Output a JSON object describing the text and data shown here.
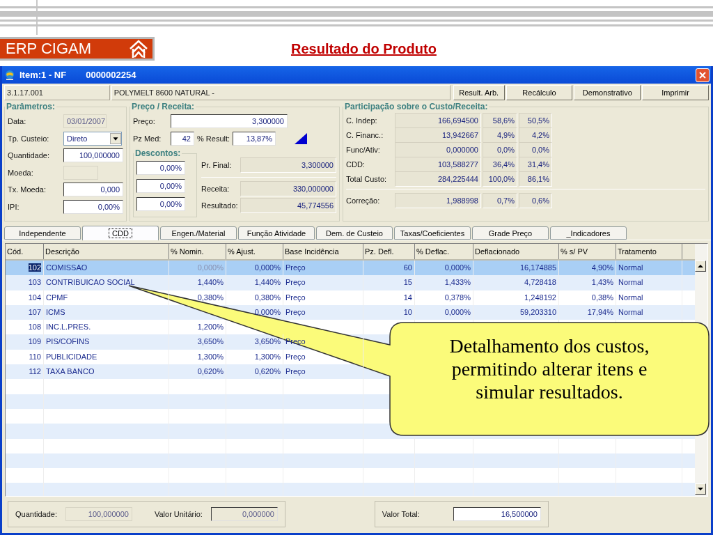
{
  "slide": {
    "logo_text": "ERP CIGAM",
    "title": "Resultado do Produto"
  },
  "window": {
    "title": "Item:1 - NF",
    "document_number": "0000002254"
  },
  "item": {
    "code": "3.1.17.001",
    "description": "POLYMELT 8600 NATURAL -"
  },
  "buttons": [
    {
      "label": "Result. Arb."
    },
    {
      "label": "Recálculo"
    },
    {
      "label": "Demonstrativo"
    },
    {
      "label": "Imprimir"
    }
  ],
  "parametros": {
    "title": "Parâmetros:",
    "fields": [
      {
        "label": "Data:",
        "kind": "readonly",
        "value": "03/01/2007"
      },
      {
        "label": "Tp. Custeio:",
        "kind": "select",
        "value": "Direto"
      },
      {
        "label": "Quantidade:",
        "kind": "input",
        "value": "100,000000"
      },
      {
        "label": "Moeda:",
        "kind": "readonly"
      },
      {
        "label": "Tx. Moeda:",
        "kind": "input",
        "value": "0,000"
      },
      {
        "label": "IPI:",
        "kind": "input",
        "value": "0,00%"
      }
    ]
  },
  "preco": {
    "title": "Preço / Receita:",
    "preco": {
      "label": "Preço:",
      "value": "3,300000"
    },
    "pz_med": {
      "label": "Pz Med:",
      "value": "42"
    },
    "result": {
      "label": "% Result:",
      "value": "13,87%"
    },
    "descontos": {
      "title": "Descontos:",
      "values": [
        "0,00%",
        "0,00%",
        "0,00%"
      ]
    },
    "pr_final": {
      "label": "Pr. Final:",
      "value": "3,300000"
    },
    "receita": {
      "label": "Receita:",
      "value": "330,000000"
    },
    "resultado": {
      "label": "Resultado:",
      "value": "45,774556"
    }
  },
  "participacao": {
    "title": "Participação sobre o Custo/Receita:",
    "rows": [
      {
        "label": "C. Indep:",
        "value": "166,694500",
        "pct_custo": "58,6%",
        "pct_receita": "50,5%"
      },
      {
        "label": "C. Financ.:",
        "value": "13,942667",
        "pct_custo": "4,9%",
        "pct_receita": "4,2%"
      },
      {
        "label": "Func/Ativ:",
        "value": "0,000000",
        "pct_custo": "0,0%",
        "pct_receita": "0,0%"
      },
      {
        "label": "CDD:",
        "value": "103,588277",
        "pct_custo": "36,4%",
        "pct_receita": "31,4%"
      },
      {
        "label": "Total Custo:",
        "value": "284,225444",
        "pct_custo": "100,0%",
        "pct_receita": "86,1%"
      }
    ],
    "correcao": {
      "label": "Correção:",
      "value": "1,988998",
      "pct_custo": "0,7%",
      "pct_receita": "0,6%"
    }
  },
  "tabs": [
    {
      "label": "Independente",
      "selected": false
    },
    {
      "label": "CDD",
      "selected": true
    },
    {
      "label": "Engen./Material",
      "selected": false
    },
    {
      "label": "Função Atividade",
      "selected": false
    },
    {
      "label": "Dem. de Custeio",
      "selected": false
    },
    {
      "label": "Taxas/Coeficientes",
      "selected": false
    },
    {
      "label": "Grade Preço",
      "selected": false
    },
    {
      "label": "_Indicadores",
      "selected": false
    }
  ],
  "table": {
    "columns": [
      "Cód.",
      "Descrição",
      "% Nomin.",
      "% Ajust.",
      "Base Incidência",
      "Pz. Defl.",
      "% Deflac.",
      "Deflacionado",
      "% s/ PV",
      "Tratamento"
    ],
    "rows": [
      {
        "selected": true,
        "nomin_disabled": true,
        "cells": [
          "102",
          "COMISSAO",
          "0,000%",
          "0,000%",
          "Preço",
          "60",
          "0,000%",
          "16,174885",
          "4,90%",
          "Normal"
        ]
      },
      {
        "selected": false,
        "nomin_disabled": false,
        "cells": [
          "103",
          "CONTRIBUICAO SOCIAL",
          "1,440%",
          "1,440%",
          "Preço",
          "15",
          "1,433%",
          "4,728418",
          "1,43%",
          "Normal"
        ]
      },
      {
        "selected": false,
        "nomin_disabled": false,
        "cells": [
          "104",
          "CPMF",
          "0,380%",
          "0,380%",
          "Preço",
          "14",
          "0,378%",
          "1,248192",
          "0,38%",
          "Normal"
        ]
      },
      {
        "selected": false,
        "cells": [
          "107",
          "ICMS",
          null,
          "0,000%",
          "Preço",
          "10",
          "0,000%",
          "59,203310",
          "17,94%",
          "Normal"
        ]
      },
      {
        "selected": false,
        "nomin_disabled": false,
        "cells": [
          "108",
          "INC.L.PRES.",
          "1,200%",
          null,
          null,
          null,
          null,
          null,
          null,
          null
        ]
      },
      {
        "selected": false,
        "nomin_disabled": false,
        "cells": [
          "109",
          "PIS/COFINS",
          "3,650%",
          "3,650%",
          "Preço",
          null,
          null,
          null,
          null,
          null
        ]
      },
      {
        "selected": false,
        "nomin_disabled": false,
        "cells": [
          "110",
          "PUBLICIDADE",
          "1,300%",
          "1,300%",
          "Preço",
          null,
          null,
          null,
          null,
          null
        ]
      },
      {
        "selected": false,
        "nomin_disabled": false,
        "cells": [
          "112",
          "TAXA BANCO",
          "0,620%",
          "0,620%",
          "Preço",
          null,
          null,
          null,
          null,
          null
        ]
      }
    ]
  },
  "footer": {
    "quantidade": {
      "label": "Quantidade:",
      "value": "100,000000"
    },
    "valor_unitario": {
      "label": "Valor Unitário:",
      "value": "0,000000"
    },
    "valor_total": {
      "label": "Valor Total:",
      "value": "16,500000"
    }
  },
  "callout": {
    "text": "Detalhamento dos custos, permitindo alterar itens e simular resultados."
  }
}
